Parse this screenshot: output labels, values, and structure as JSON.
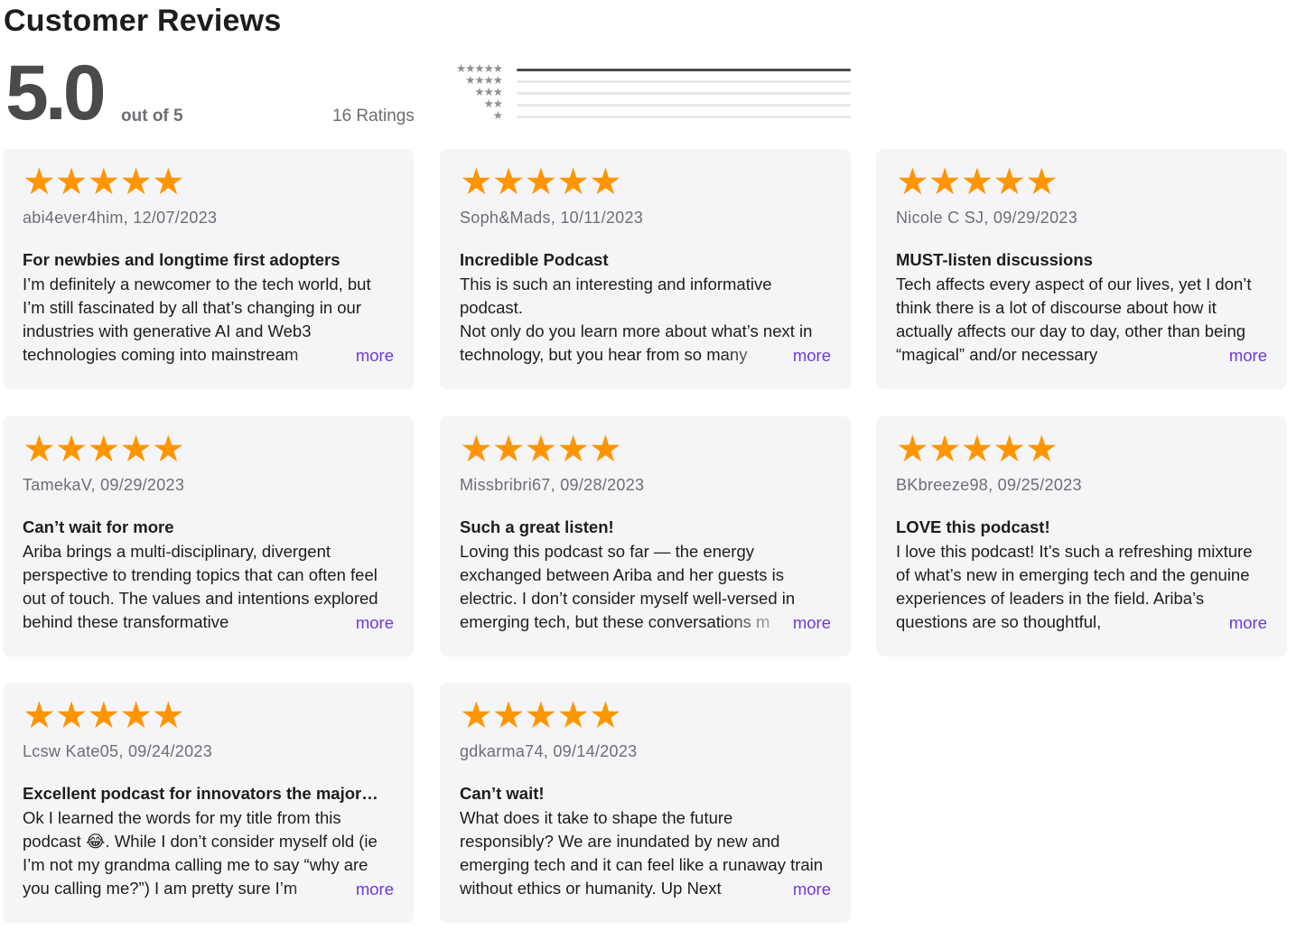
{
  "header": {
    "title": "Customer Reviews"
  },
  "summary": {
    "score": "5.0",
    "out_of": "out of 5",
    "ratings_count": "16 Ratings",
    "histogram": [
      {
        "stars": "★★★★★",
        "fraction": 1.0
      },
      {
        "stars": "★★★★",
        "fraction": 0.0
      },
      {
        "stars": "★★★",
        "fraction": 0.0
      },
      {
        "stars": "★★",
        "fraction": 0.0
      },
      {
        "stars": "★",
        "fraction": 0.0
      }
    ]
  },
  "colors": {
    "star": "#ff9500",
    "more_link": "#6e3ad6",
    "card_bg": "#f5f5f7"
  },
  "reviews": [
    {
      "stars": "★★★★★",
      "byline": "abi4ever4him, 12/07/2023",
      "title": "For newbies and longtime first adopters",
      "body": "I’m definitely a newcomer to the tech world, but I’m still fascinated by all that’s changing in our industries with generative AI and Web3 technologies coming into mainstream",
      "more": "more"
    },
    {
      "stars": "★★★★★",
      "byline": "Soph&Mads, 10/11/2023",
      "title": "Incredible Podcast",
      "body": "This is such an interesting and informative podcast.\nNot only do you learn more about what’s next in technology, but you hear from so many",
      "more": "more"
    },
    {
      "stars": "★★★★★",
      "byline": "Nicole C SJ, 09/29/2023",
      "title": "MUST-listen discussions",
      "body": "Tech affects every aspect of our lives, yet I don’t think there is a lot of discourse about how it actually affects our day to day, other than being “magical” and/or necessary",
      "more": "more"
    },
    {
      "stars": "★★★★★",
      "byline": "TamekaV, 09/29/2023",
      "title": "Can’t wait for more",
      "body": "Ariba brings a multi-disciplinary, divergent perspective to trending topics that can often feel out of touch. The values and intentions explored behind these transformative",
      "more": "more"
    },
    {
      "stars": "★★★★★",
      "byline": "Missbribri67, 09/28/2023",
      "title": "Such a great listen!",
      "body": "Loving this podcast so far — the energy exchanged between Ariba and her guests is electric. I don’t consider myself well-versed in emerging tech, but these conversations m",
      "more": "more"
    },
    {
      "stars": "★★★★★",
      "byline": "BKbreeze98, 09/25/2023",
      "title": "LOVE this podcast!",
      "body": "I love this podcast! It’s such a refreshing mixture of what’s new in emerging tech and the genuine experiences of leaders in the field. Ariba’s questions are so thoughtful,",
      "more": "more"
    },
    {
      "stars": "★★★★★",
      "byline": "Lcsw Kate05, 09/24/2023",
      "title": "Excellent podcast for innovators the major…",
      "body": "Ok I learned the words for my title from this podcast 😂. While I don’t consider myself old (ie I’m not my grandma calling me to say “why are you calling me?”) I am pretty sure I’m",
      "more": "more"
    },
    {
      "stars": "★★★★★",
      "byline": "gdkarma74, 09/14/2023",
      "title": "Can’t wait!",
      "body": "What does it take to shape the future responsibly? We are inundated by new and emerging tech and it can feel like a runaway train without ethics or humanity. Up Next",
      "more": "more"
    }
  ]
}
